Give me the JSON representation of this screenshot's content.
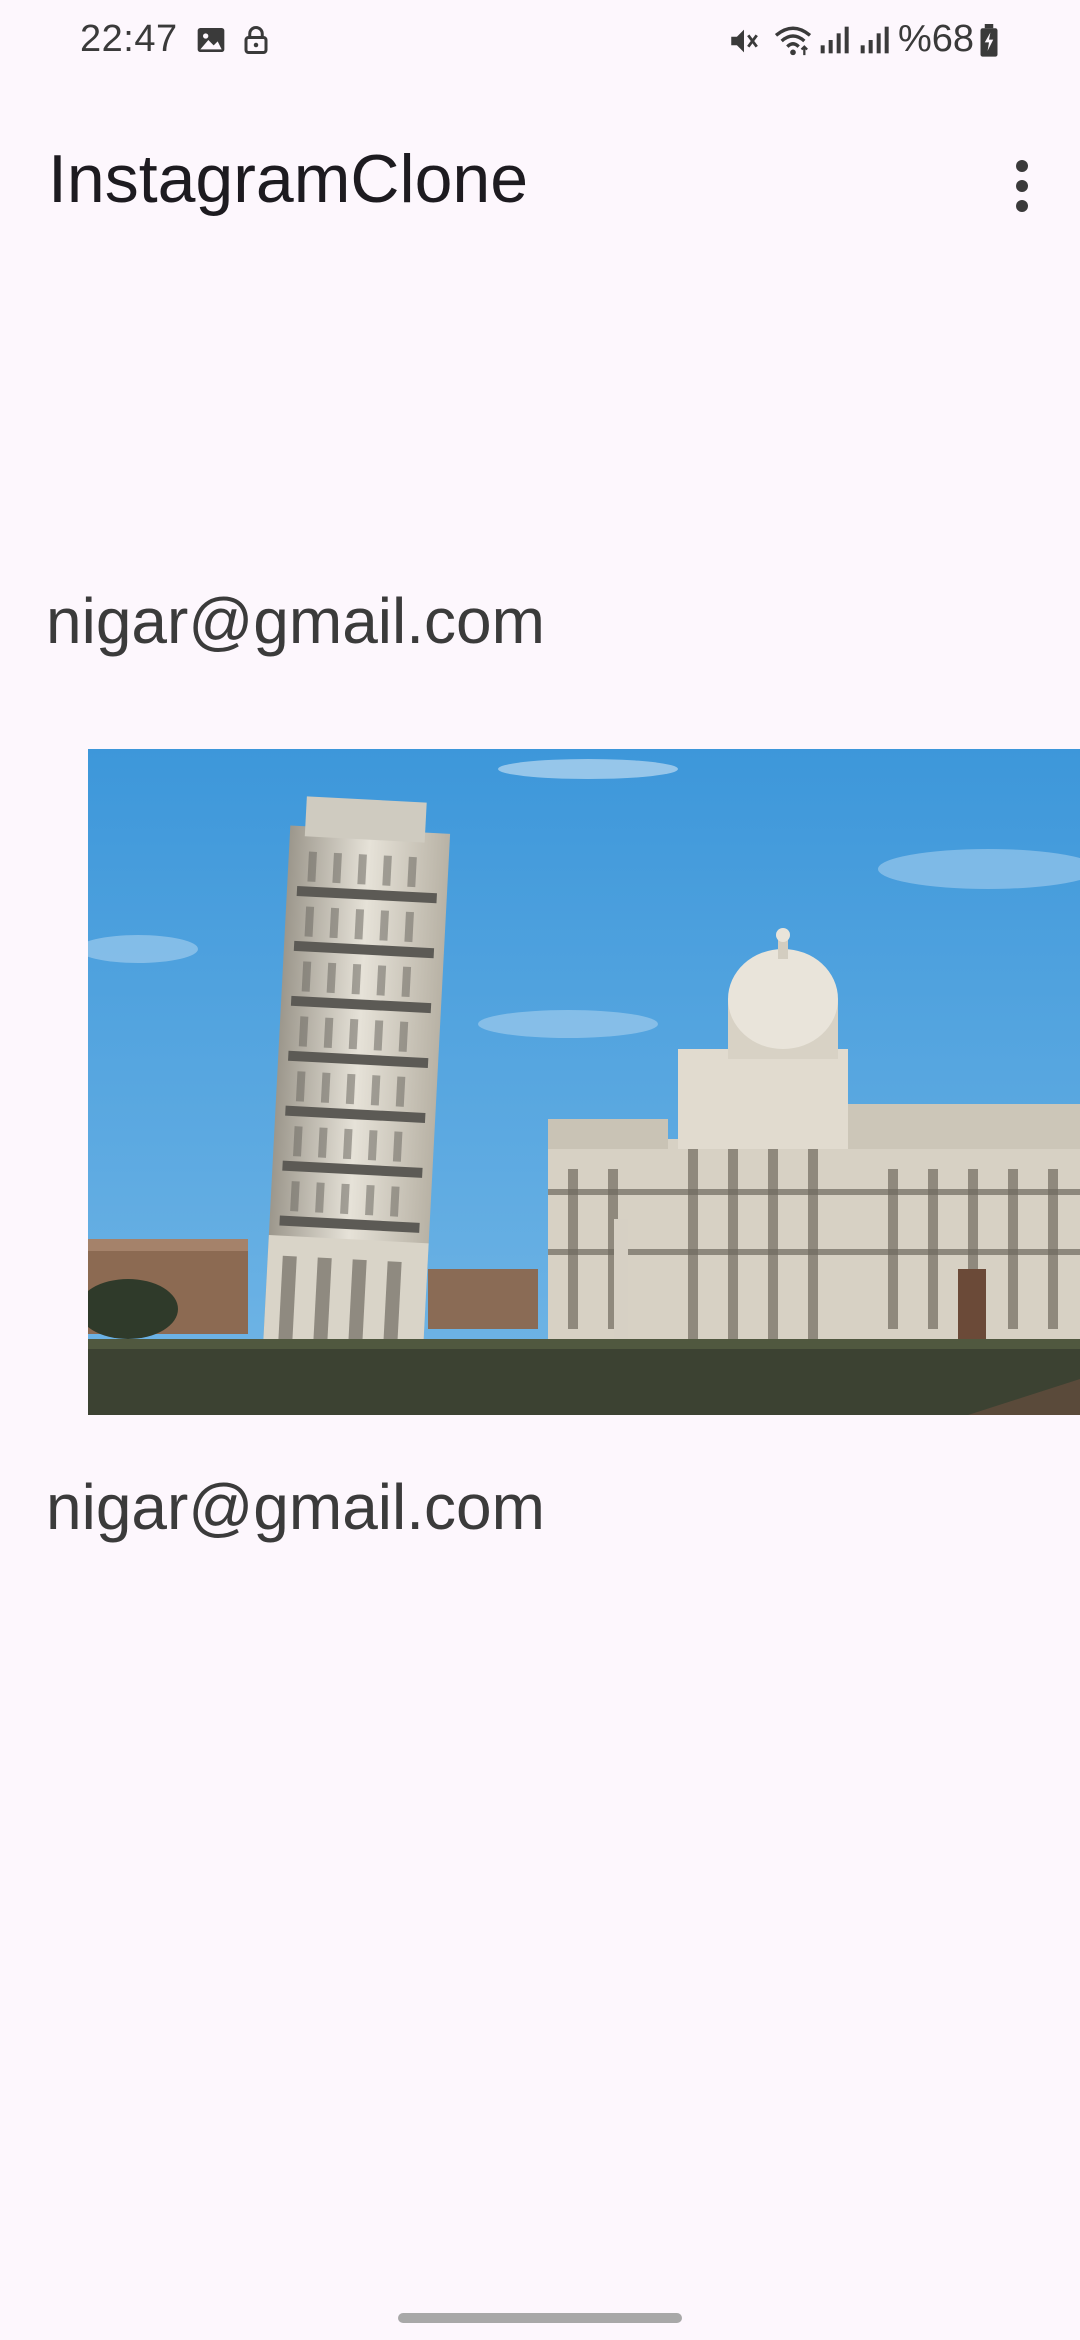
{
  "status_bar": {
    "time": "22:47",
    "battery_percent": "%68",
    "icons": [
      "gallery-icon",
      "lock-icon",
      "mute-icon",
      "wifi-icon",
      "signal-icon",
      "signal-icon",
      "battery-charging-icon"
    ]
  },
  "app_bar": {
    "title": "InstagramClone",
    "menu_icon": "more-vert-icon"
  },
  "feed": {
    "posts": [
      {
        "email": "nigar@gmail.com",
        "image_subject": "Leaning Tower of Pisa and Pisa Cathedral"
      },
      {
        "email": "nigar@gmail.com"
      }
    ]
  },
  "colors": {
    "background": "#fdf7fd",
    "text_primary": "#1d1b20",
    "text_secondary": "#3b3b3b",
    "sky": "#4aa3e0"
  }
}
